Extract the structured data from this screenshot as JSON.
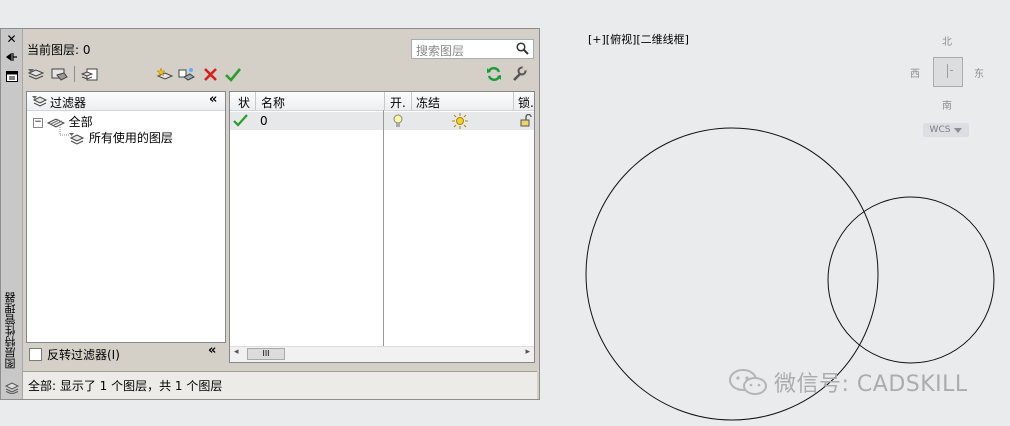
{
  "viewport": {
    "label": "[+][俯视][二维线框]"
  },
  "viewcube": {
    "north": "北",
    "south": "南",
    "east": "东",
    "west": "西",
    "ucs": "WCS"
  },
  "palette": {
    "vertical_title": "图层特性管理器",
    "current_layer": "当前图层: 0",
    "search_placeholder": "搜索图层",
    "filter_panel": {
      "header": "过滤器",
      "tree": [
        "全部",
        "所有使用的图层"
      ],
      "invert_label": "反转过滤器(I)"
    },
    "layer_list": {
      "columns": [
        "状",
        "名称",
        "开.",
        "冻结",
        "锁."
      ],
      "rows": [
        {
          "name": "0"
        }
      ],
      "scroll_thumb": "III"
    },
    "status_text": "全部: 显示了 1 个图层，共 1 个图层"
  },
  "watermark": {
    "text": "微信号: CADSKILL"
  },
  "colors": {
    "status_ok": "#2a9d2a",
    "delete": "#d42020",
    "refresh": "#1e9a3c"
  }
}
